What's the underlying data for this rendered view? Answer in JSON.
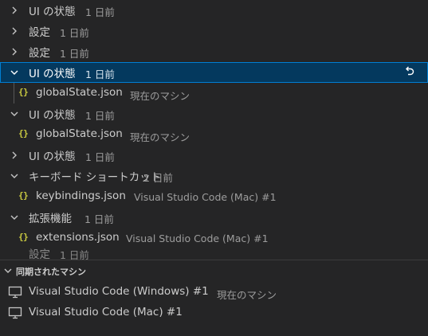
{
  "tree": {
    "rows": [
      {
        "label": "UI の状態",
        "desc": "1 日前",
        "expanded": false
      },
      {
        "label": "設定",
        "desc": "1 日前",
        "expanded": false
      },
      {
        "label": "設定",
        "desc": "1 日前",
        "expanded": false
      },
      {
        "label": "UI の状態",
        "desc": "1 日前",
        "expanded": true,
        "selected": true
      },
      {
        "label": "globalState.json",
        "desc": "現在のマシン",
        "child": true
      },
      {
        "label": "UI の状態",
        "desc": "1 日前",
        "expanded": true
      },
      {
        "label": "globalState.json",
        "desc": "現在のマシン",
        "child": true
      },
      {
        "label": "UI の状態",
        "desc": "1 日前",
        "expanded": false
      },
      {
        "label": "キーボード ショートカット",
        "desc": "1 日前",
        "expanded": true
      },
      {
        "label": "keybindings.json",
        "desc": "Visual Studio Code (Mac) #1",
        "child": true
      },
      {
        "label": "拡張機能",
        "desc": "1 日前",
        "expanded": true
      },
      {
        "label": "extensions.json",
        "desc": "Visual Studio Code (Mac) #1",
        "child": true
      },
      {
        "label": "設定",
        "desc": "1 日前",
        "partial": true
      }
    ]
  },
  "synced": {
    "title": "同期されたマシン",
    "machines": [
      {
        "name": "Visual Studio Code (Windows) #1",
        "desc": "現在のマシン"
      },
      {
        "name": "Visual Studio Code (Mac) #1",
        "desc": ""
      }
    ]
  },
  "icons": {
    "json": "{}",
    "revert": "revert-icon",
    "monitor": "monitor-icon"
  },
  "colors": {
    "background": "#252526",
    "selected": "#04395e",
    "selected_border": "#007fd4",
    "json_icon": "#cbcb41",
    "description": "#9d9d9d"
  }
}
